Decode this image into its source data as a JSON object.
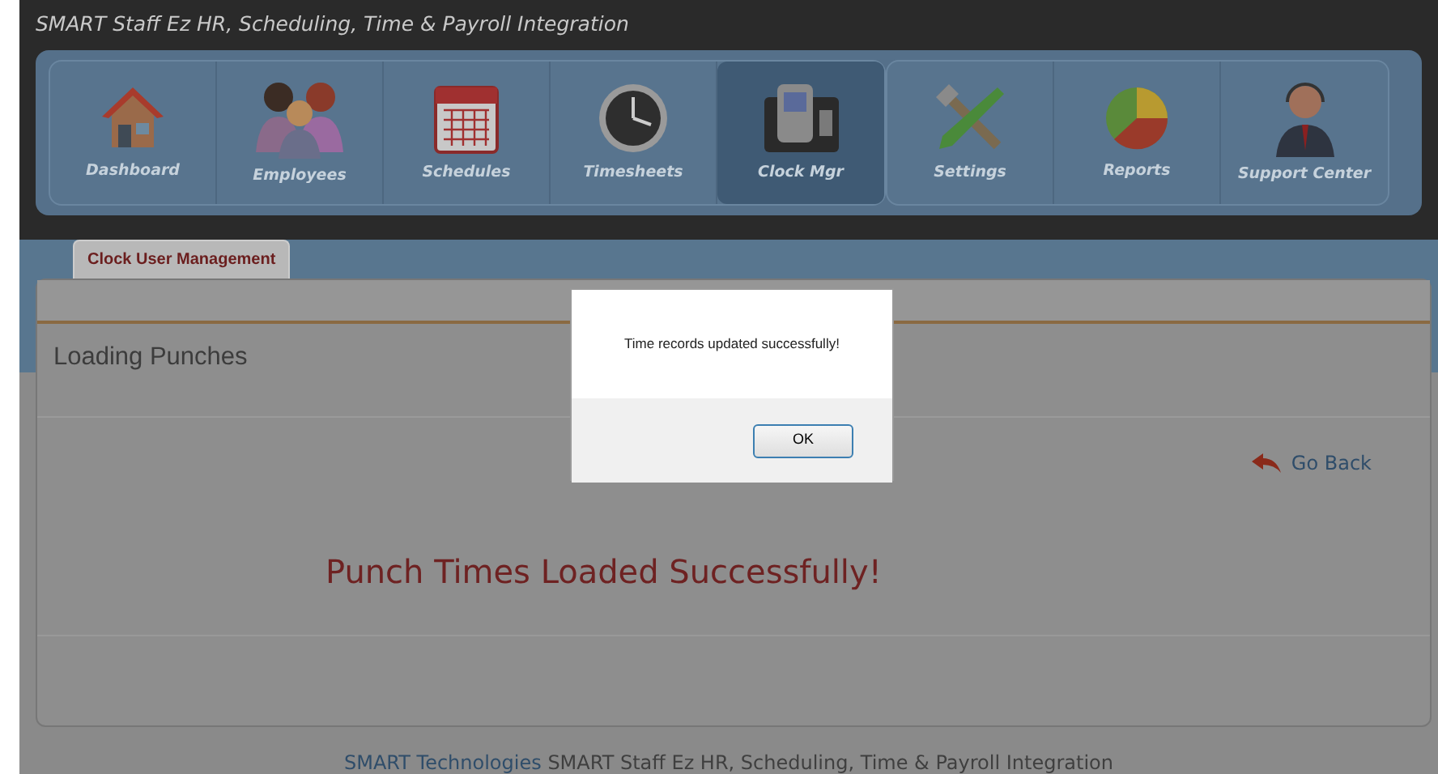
{
  "window": {
    "title": "SMART Staff Ez HR, Scheduling, Time & Payroll Integration"
  },
  "nav": {
    "groups": [
      [
        {
          "label": "Dashboard",
          "selected": false
        },
        {
          "label": "Employees",
          "selected": false
        },
        {
          "label": "Schedules",
          "selected": false
        },
        {
          "label": "Timesheets",
          "selected": false
        },
        {
          "label": "Clock Mgr",
          "selected": true
        }
      ],
      [
        {
          "label": "Settings",
          "selected": false
        },
        {
          "label": "Reports",
          "selected": false
        },
        {
          "label": "Support Center",
          "selected": false
        }
      ]
    ]
  },
  "tabs": [
    {
      "label": "Clock User Management",
      "selected": true
    }
  ],
  "panel": {
    "heading": "Loading Punches",
    "back_link": "Go Back",
    "message": "Punch Times Loaded Successfully!"
  },
  "footer": {
    "link": "SMART Technologies",
    "text": "SMART Staff Ez HR, Scheduling, Time & Payroll Integration"
  },
  "dialog": {
    "message": "Time records updated successfully!",
    "button": "OK"
  }
}
